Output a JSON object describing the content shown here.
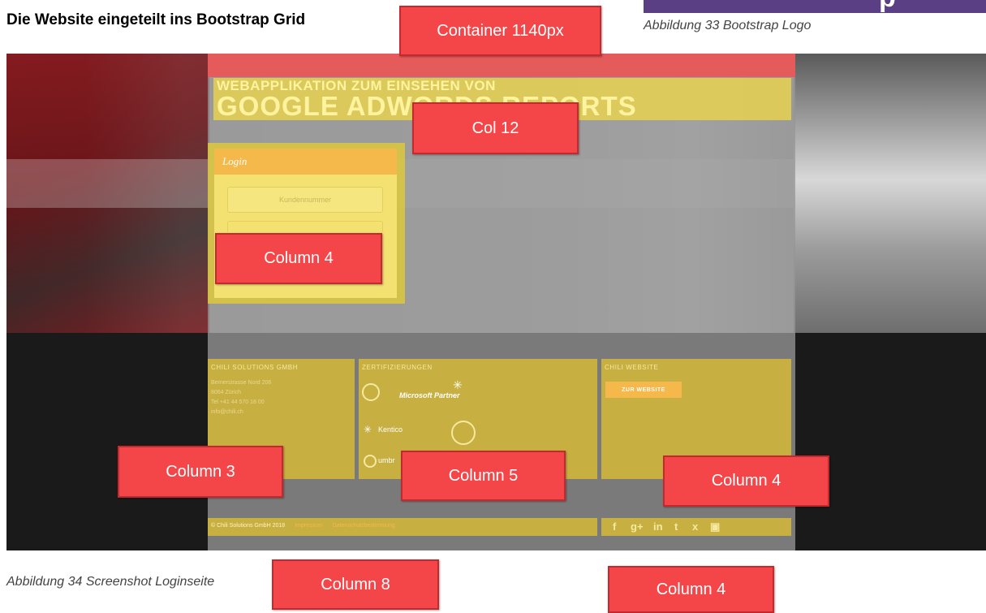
{
  "heading": "Die Website eingeteilt ins Bootstrap Grid",
  "caption_logo": "Abbildung 33 Bootstrap Logo",
  "caption_screenshot": "Abbildung 34 Screenshot Loginseite",
  "labels": {
    "container": "Container 1140px",
    "col12": "Col 12",
    "login_col": "Column 4",
    "footer_col3": "Column 3",
    "footer_col5": "Column 5",
    "footer_col4": "Column 4",
    "bottom_col8": "Column 8",
    "bottom_col4": "Column 4"
  },
  "screenshot": {
    "title_line1": "WEBAPPLIKATION ZUM EINSEHEN VON",
    "title_line2": "GOOGLE ADWORDS REPORTS",
    "login": {
      "header": "Login",
      "field_placeholder": "Kundennummer"
    },
    "footer": {
      "col1_heading": "CHILI SOLUTIONS GMBH",
      "col1_lines": [
        "Bernerstrasse Nord 206",
        "8064 Zürich",
        "Tel +41 44 570 18 00",
        "info@chili.ch"
      ],
      "col2_heading": "ZERTIFIZIERUNGEN",
      "cert_microsoft": "Microsoft Partner",
      "cert_kentico": "Kentico",
      "cert_umbraco": "umbr",
      "col3_heading": "CHILI WEBSITE",
      "website_button": "ZUR WEBSITE",
      "copyright": "© Chili Solutions GmbH 2018",
      "impressum": "Impressum",
      "datenschutz": "Datenschutzbestimmung",
      "social": [
        "f",
        "g+",
        "in",
        "t",
        "x",
        "yt"
      ]
    }
  },
  "colors": {
    "label_red": "#f44649",
    "grid_yellow": "#e6d250",
    "bootstrap_purple": "#5a3f85"
  }
}
